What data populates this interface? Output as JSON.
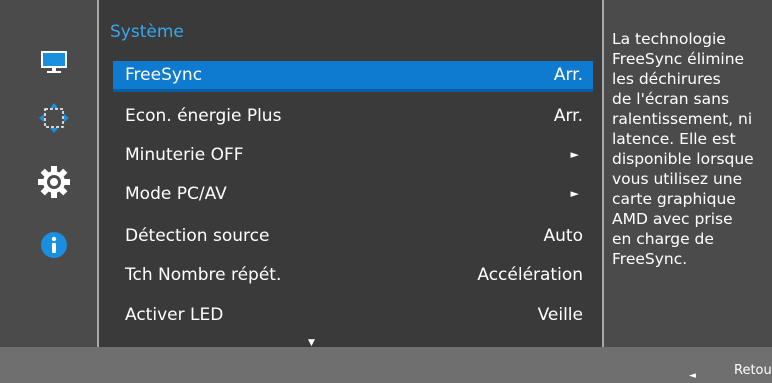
{
  "sidebar": {
    "icons": [
      "monitor-icon",
      "move-arrows-icon",
      "gear-icon",
      "info-icon"
    ]
  },
  "menu": {
    "title": "Système",
    "items": [
      {
        "label": "FreeSync",
        "value": "Arr.",
        "selected": true
      },
      {
        "label": "Econ. énergie Plus",
        "value": "Arr."
      },
      {
        "label": "Minuterie OFF",
        "value": "►"
      },
      {
        "label": "Mode PC/AV",
        "value": "►"
      },
      {
        "label": "Détection source",
        "value": "Auto"
      },
      {
        "label": "Tch Nombre répét.",
        "value": "Accélération"
      },
      {
        "label": "Activer LED",
        "value": "Veille"
      }
    ],
    "scroll_indicator": "▼"
  },
  "help": {
    "text": "La technologie\nFreeSync élimine\nles déchirures\nde l'écran sans\nralentissement, ni\nlatence. Elle est\ndisponible lorsque\nvous utilisez une\ncarte graphique\nAMD avec prise\nen charge de\nFreeSync."
  },
  "footer": {
    "back_arrow": "◄",
    "back_label": "Retour"
  },
  "colors": {
    "accent": "#36a8ee",
    "selection": "#0f7bd0",
    "menu_bg": "#3a3a3a",
    "sidebar_bg": "#4b4b4b"
  }
}
